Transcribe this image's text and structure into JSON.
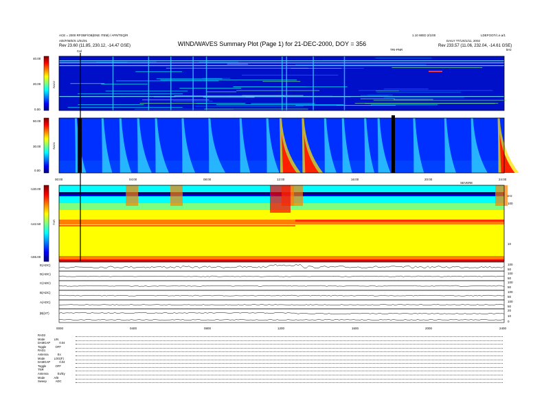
{
  "header": {
    "title": "WIND/WAVES Summary Plot (Page 1) for 21-DEC-2000, DOY = 356",
    "left_line1": "ACE = 2000 RFOBF/OB(ENE ITEM) / AFR/TEQ/R",
    "left_line2": "A/E/F/M/E/S 1/01/01",
    "left_rev": "Rev 23.60 (11.85, 230.12, -14.47 GSE)",
    "right_line1": "1.10 WED 2/1/00",
    "right_line2": "LDEFOOT/c.e.a/1",
    "right_line3": "DAILY TT/US/1/11, 2002",
    "right_rev": "Rev 233.57 (11.06, 232.04, -14.61 GSE)",
    "mid_label": "TRI-PNR",
    "top_right_tag": "kHz",
    "marker_label": "Cal"
  },
  "colors": {
    "colormap": [
      "#00007f",
      "#0000ff",
      "#0080ff",
      "#00ffff",
      "#7fff7f",
      "#ffff00",
      "#ff8000",
      "#ff0000",
      "#7f0000"
    ],
    "background": "#ffffff",
    "frame": "#000000"
  },
  "chart_data": [
    {
      "type": "heatmap",
      "name": "RAD2",
      "ylabel": "RAD2",
      "colorbar_ticks": [
        "40.00",
        "20.00",
        "0.00"
      ],
      "colorbar_range": [
        0,
        40
      ]
    },
    {
      "type": "heatmap",
      "name": "RAD1",
      "ylabel": "RAD1",
      "colorbar_ticks": [
        "50.00",
        "30.00",
        "0.00"
      ],
      "colorbar_range": [
        0,
        50
      ],
      "xticks": [
        "00:00",
        "04:00",
        "08:00",
        "12:00",
        "16:00",
        "20:00",
        "24:00"
      ],
      "x_corner_label": "SEVERE"
    },
    {
      "type": "heatmap",
      "name": "TNR",
      "ylabel": "TNR",
      "colorbar_ticks": [
        "-130.00",
        "-142.50",
        "-155.00"
      ],
      "colorbar_range": [
        -155,
        -130
      ],
      "right_ticks": [
        "100",
        "10"
      ],
      "right_unit": "kHz"
    },
    {
      "type": "line",
      "panels": [
        {
          "label": "E(ADC)",
          "right_ticks": [
            "100",
            "50"
          ]
        },
        {
          "label": "D(ADC)",
          "right_ticks": [
            "100",
            "50"
          ]
        },
        {
          "label": "C(ADC)",
          "right_ticks": [
            "100",
            "50"
          ]
        },
        {
          "label": "B(ADC)",
          "right_ticks": [
            "100",
            "50"
          ]
        },
        {
          "label": "A(ADC)",
          "right_ticks": [
            "100",
            "50"
          ]
        },
        {
          "label": "|B|(nT)",
          "right_ticks": [
            "20",
            "10",
            "0"
          ]
        }
      ],
      "xticks": [
        "0000",
        "0400",
        "0800",
        "1200",
        "1600",
        "2000",
        "2400"
      ]
    }
  ],
  "footer": {
    "rows": [
      {
        "k": "RAD2",
        "v": ""
      },
      {
        "k": "Mode",
        "v": "LIN"
      },
      {
        "k": "DAMGAP",
        "v": "0.04"
      },
      {
        "k": "Toggle",
        "v": "OFF"
      },
      {
        "k": "RAD1",
        "v": ""
      },
      {
        "k": "Antenna",
        "v": "Ex"
      },
      {
        "k": "Mode",
        "v": "LOG(F)"
      },
      {
        "k": "DAMGAP",
        "v": "0.04"
      },
      {
        "k": "Toggle",
        "v": "OFF"
      },
      {
        "k": "TNR",
        "v": ""
      },
      {
        "k": "Antenna",
        "v": "Ex/Ey"
      },
      {
        "k": "Mode",
        "v": "A/B"
      },
      {
        "k": "Sweep",
        "v": "ADC"
      }
    ]
  }
}
